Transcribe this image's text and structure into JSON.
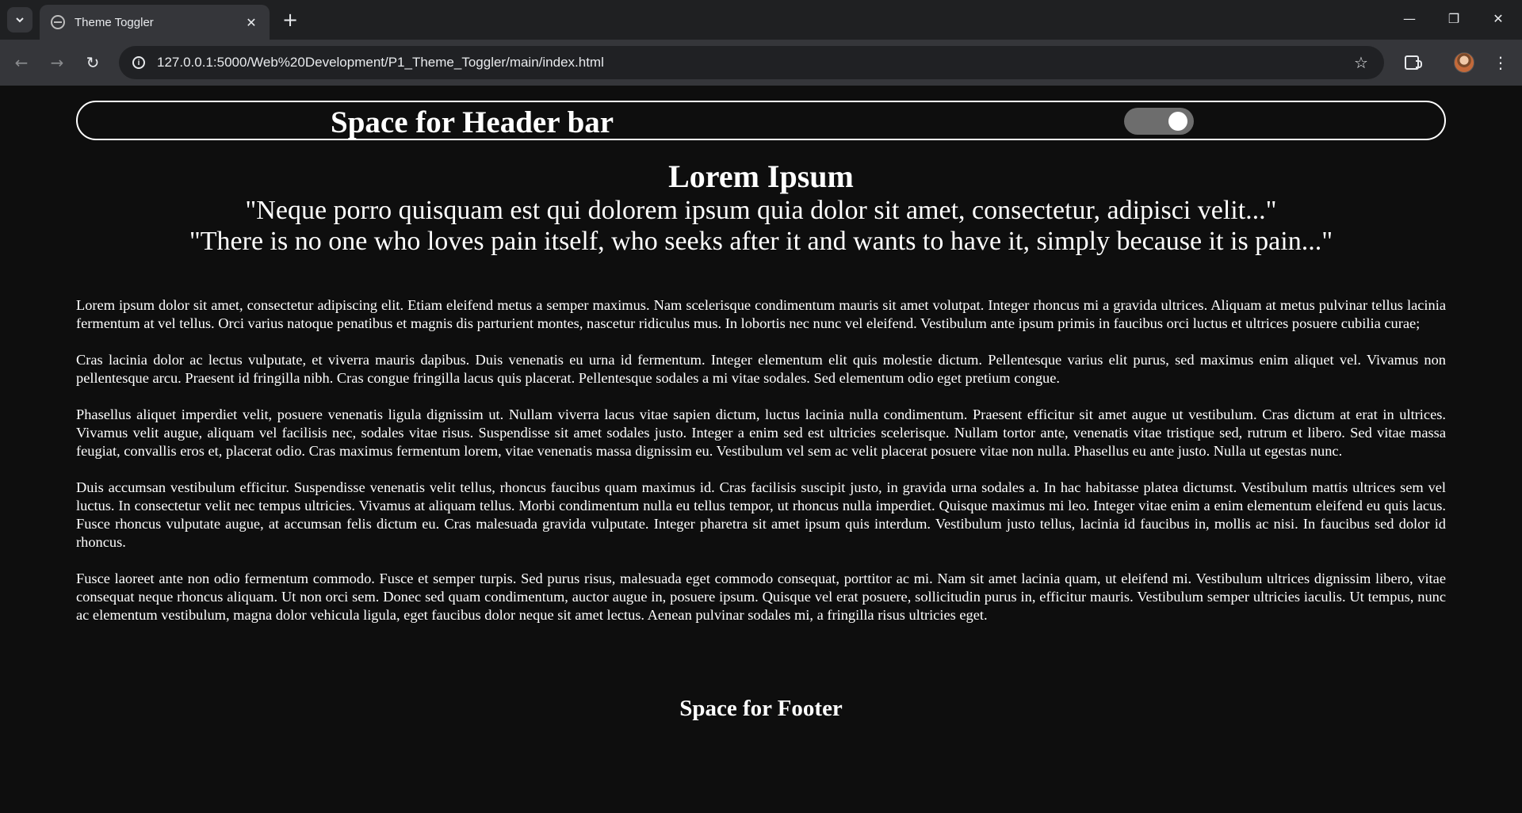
{
  "browser": {
    "tab_title": "Theme Toggler",
    "url": "127.0.0.1:5000/Web%20Development/P1_Theme_Toggler/main/index.html",
    "icons": {
      "tab_search": "chevron-down-icon",
      "close_tab": "close-icon",
      "new_tab": "plus-icon",
      "back": "arrow-left-icon",
      "forward": "arrow-right-icon",
      "reload": "reload-icon",
      "site_info": "info-icon",
      "bookmark": "star-icon",
      "extensions": "puzzle-icon",
      "menu": "kebab-menu-icon"
    }
  },
  "header": {
    "title": "Space for Header bar",
    "toggle_state": "on"
  },
  "hero": {
    "title": "Lorem Ipsum",
    "quote1": "\"Neque porro quisquam est qui dolorem ipsum quia dolor sit amet, consectetur, adipisci velit...\"",
    "quote2": "\"There is no one who loves pain itself, who seeks after it and wants to have it, simply because it is pain...\""
  },
  "paragraphs": [
    "Lorem ipsum dolor sit amet, consectetur adipiscing elit. Etiam eleifend metus a semper maximus. Nam scelerisque condimentum mauris sit amet volutpat. Integer rhoncus mi a gravida ultrices. Aliquam at metus pulvinar tellus lacinia fermentum at vel tellus. Orci varius natoque penatibus et magnis dis parturient montes, nascetur ridiculus mus. In lobortis nec nunc vel eleifend. Vestibulum ante ipsum primis in faucibus orci luctus et ultrices posuere cubilia curae;",
    "Cras lacinia dolor ac lectus vulputate, et viverra mauris dapibus. Duis venenatis eu urna id fermentum. Integer elementum elit quis molestie dictum. Pellentesque varius elit purus, sed maximus enim aliquet vel. Vivamus non pellentesque arcu. Praesent id fringilla nibh. Cras congue fringilla lacus quis placerat. Pellentesque sodales a mi vitae sodales. Sed elementum odio eget pretium congue.",
    "Phasellus aliquet imperdiet velit, posuere venenatis ligula dignissim ut. Nullam viverra lacus vitae sapien dictum, luctus lacinia nulla condimentum. Praesent efficitur sit amet augue ut vestibulum. Cras dictum at erat in ultrices. Vivamus velit augue, aliquam vel facilisis nec, sodales vitae risus. Suspendisse sit amet sodales justo. Integer a enim sed est ultricies scelerisque. Nullam tortor ante, venenatis vitae tristique sed, rutrum et libero. Sed vitae massa feugiat, convallis eros et, placerat odio. Cras maximus fermentum lorem, vitae venenatis massa dignissim eu. Vestibulum vel sem ac velit placerat posuere vitae non nulla. Phasellus eu ante justo. Nulla ut egestas nunc.",
    "Duis accumsan vestibulum efficitur. Suspendisse venenatis velit tellus, rhoncus faucibus quam maximus id. Cras facilisis suscipit justo, in gravida urna sodales a. In hac habitasse platea dictumst. Vestibulum mattis ultrices sem vel luctus. In consectetur velit nec tempus ultricies. Vivamus at aliquam tellus. Morbi condimentum nulla eu tellus tempor, ut rhoncus nulla imperdiet. Quisque maximus mi leo. Integer vitae enim a enim elementum eleifend eu quis lacus. Fusce rhoncus vulputate augue, at accumsan felis dictum eu. Cras malesuada gravida vulputate. Integer pharetra sit amet ipsum quis interdum. Vestibulum justo tellus, lacinia id faucibus in, mollis ac nisi. In faucibus sed dolor id rhoncus.",
    "Fusce laoreet ante non odio fermentum commodo. Fusce et semper turpis. Sed purus risus, malesuada eget commodo consequat, porttitor ac mi. Nam sit amet lacinia quam, ut eleifend mi. Vestibulum ultrices dignissim libero, vitae consequat neque rhoncus aliquam. Ut non orci sem. Donec sed quam condimentum, auctor augue in, posuere ipsum. Quisque vel erat posuere, sollicitudin purus in, efficitur mauris. Vestibulum semper ultricies iaculis. Ut tempus, nunc ac elementum vestibulum, magna dolor vehicula ligula, eget faucibus dolor neque sit amet lectus. Aenean pulvinar sodales mi, a fringilla risus ultricies eget."
  ],
  "footer": {
    "text": "Space for Footer"
  },
  "colors": {
    "page_background": "#0e0e0e",
    "text": "#ffffff",
    "toggle_track": "#6d6d6d",
    "toggle_knob": "#ffffff"
  }
}
